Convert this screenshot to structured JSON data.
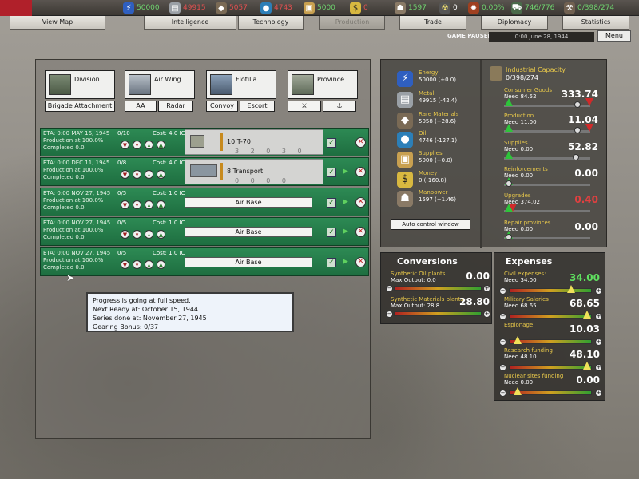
{
  "resources_bar": {
    "energy": "50000",
    "metal": "49915",
    "rare": "5057",
    "oil": "4743",
    "supplies": "5000",
    "money": "0",
    "manpower": "1597",
    "nuclear": "0",
    "dissent": "0.00%",
    "transport": "746/776",
    "ic": "0/398/274"
  },
  "tabs": [
    "View Map",
    "Intelligence",
    "Technology",
    "Production",
    "Trade",
    "Diplomacy",
    "Statistics"
  ],
  "status": {
    "paused": "GAME PAUSED",
    "date": "0:00 June 28, 1944",
    "menu": "Menu"
  },
  "unit_buttons": [
    "Division",
    "Air Wing",
    "Flotilla",
    "Province"
  ],
  "sub_buttons": [
    "Brigade Attachment",
    "AA",
    "Radar",
    "Convoy",
    "Escort"
  ],
  "queue": [
    {
      "eta": "ETA: 0:00 MAY 16, 1945",
      "prod": "Production at 100.0%",
      "completed": "Completed 0.0",
      "qty": "0/10",
      "cost": "Cost: 4.0 IC",
      "unit": "10 T-70",
      "digits": "3 2 0 3 0"
    },
    {
      "eta": "ETA: 0:00 DEC 11, 1945",
      "prod": "Production at 100.0%",
      "completed": "Completed 0.0",
      "qty": "0/8",
      "cost": "Cost: 4.0 IC",
      "unit": "8 Transport",
      "digits": "0 0 0 0"
    },
    {
      "eta": "ETA: 0:00 NOV 27, 1945",
      "prod": "Production at 100.0%",
      "completed": "Completed 0.0",
      "qty": "0/5",
      "cost": "Cost: 1.0 IC",
      "unit": "Air Base"
    },
    {
      "eta": "ETA: 0:00 NOV 27, 1945",
      "prod": "Production at 100.0%",
      "completed": "Completed 0.0",
      "qty": "0/5",
      "cost": "Cost: 1.0 IC",
      "unit": "Air Base"
    },
    {
      "eta": "ETA: 0:00 NOV 27, 1945",
      "prod": "Production at 100.0%",
      "completed": "Completed 0.0",
      "qty": "0/5",
      "cost": "Cost: 1.0 IC",
      "unit": "Air Base"
    }
  ],
  "tooltip": [
    "Progress is going at full speed.",
    "Next Ready at: October 15, 1944",
    "Series done at: November 27, 1945",
    "Gearing Bonus: 0/37"
  ],
  "res_list": [
    {
      "name": "Energy",
      "value": "50000 (+0.0)",
      "icon": "lightning-icon",
      "color": "#2f5fc0"
    },
    {
      "name": "Metal",
      "value": "49915 (-42.4)",
      "icon": "metal-bars-icon",
      "color": "#9aa0a6"
    },
    {
      "name": "Rare Materials",
      "value": "5058 (+28.6)",
      "icon": "rare-materials-icon",
      "color": "#7a6a55"
    },
    {
      "name": "Oil",
      "value": "4746 (-127.1)",
      "icon": "oil-drop-icon",
      "color": "#2c7fb8"
    },
    {
      "name": "Supplies",
      "value": "5000 (+0.0)",
      "icon": "supplies-crate-icon",
      "color": "#c8a050"
    },
    {
      "name": "Money",
      "value": "0 (-160.8)",
      "icon": "dollar-icon",
      "color": "#d8b840"
    },
    {
      "name": "Manpower",
      "value": "1597 (+1.46)",
      "icon": "manpower-icon",
      "color": "#8a7a66"
    }
  ],
  "auto_control": "Auto control window",
  "industrial": {
    "title": "Industrial Capacity",
    "value": "0/398/274"
  },
  "sliders": [
    {
      "name": "Consumer Goods",
      "need": "Need 84.52",
      "value": "333.74",
      "color": "#ffffff",
      "pos": 0.85
    },
    {
      "name": "Production",
      "need": "Need 11.00",
      "value": "11.04",
      "color": "#ffffff",
      "pos": 0.87
    },
    {
      "name": "Supplies",
      "need": "Need 0.00",
      "value": "52.82",
      "color": "#ffffff",
      "pos": 0.84
    },
    {
      "name": "Reinforcements",
      "need": "Need 0.00",
      "value": "0.00",
      "color": "#ffffff",
      "pos": 0.0
    },
    {
      "name": "Upgrades",
      "need": "Need 374.02",
      "value": "0.40",
      "color": "#e04040",
      "pos": 0.0
    },
    {
      "name": "Repair provinces",
      "need": "Need 0.00",
      "value": "0.00",
      "color": "#ffffff",
      "pos": 0.0
    }
  ],
  "conversions": {
    "title": "Conversions",
    "items": [
      {
        "name": "Synthetic Oil plants",
        "max": "Max Output: 0.0",
        "value": "0.00",
        "pos": 0.92
      },
      {
        "name": "Synthetic Materials plants",
        "max": "Max Output: 28.8",
        "value": "28.80",
        "pos": 0.92
      }
    ]
  },
  "expenses": {
    "title": "Expenses",
    "items": [
      {
        "name": "Civil expenses:",
        "need": "Need 34.00",
        "value": "34.00",
        "color": "#5fe05f",
        "pos": 0.72
      },
      {
        "name": "Military Salaries",
        "need": "Need 68.65",
        "value": "68.65",
        "color": "#ffffff",
        "pos": 0.9
      },
      {
        "name": "Espionage",
        "need": "",
        "value": "10.03",
        "color": "#ffffff",
        "pos": 0.08
      },
      {
        "name": "Research funding",
        "need": "Need 48.10",
        "value": "48.10",
        "color": "#ffffff",
        "pos": 0.9
      },
      {
        "name": "Nuclear sites funding",
        "need": "Need 0.00",
        "value": "0.00",
        "color": "#ffffff",
        "pos": 0.08
      }
    ]
  }
}
